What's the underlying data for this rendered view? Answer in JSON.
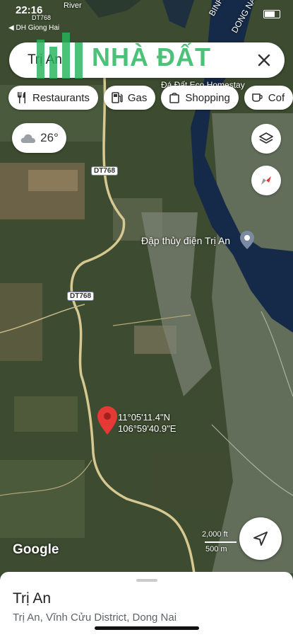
{
  "status_bar": {
    "time": "22:16",
    "back_label": "◀ DH Giong Hai"
  },
  "search": {
    "query": "Trị An"
  },
  "watermark": {
    "text": "NHÀ ĐẤT"
  },
  "chips": [
    {
      "label": "Restaurants",
      "icon": "fork-knife-icon"
    },
    {
      "label": "Gas",
      "icon": "gas-pump-icon"
    },
    {
      "label": "Shopping",
      "icon": "shopping-bag-icon"
    },
    {
      "label": "Cof",
      "icon": "coffee-icon"
    }
  ],
  "weather": {
    "temp": "26°",
    "icon": "cloud-icon"
  },
  "map": {
    "map_labels": {
      "river": "River",
      "province1": "BINH DU",
      "province2": "DONG NAI",
      "road_top": "DT768",
      "homestay": "Đá Đất Eco Homestay"
    },
    "road_shields": [
      "DT768",
      "DT768"
    ],
    "poi": {
      "name": "Đập thủy điện Trị An"
    },
    "coordinates": {
      "lat": "11°05'11.4\"N",
      "lng": "106°59'40.9\"E"
    },
    "scale": {
      "top": "2,000 ft",
      "bottom": "500 m"
    },
    "logo": "Google"
  },
  "place": {
    "title": "Trị An",
    "subtitle": "Trị An, Vĩnh Cửu District, Dong Nai"
  },
  "colors": {
    "pin": "#e53935",
    "watermark": "#27b45b",
    "water": "#152a48"
  }
}
